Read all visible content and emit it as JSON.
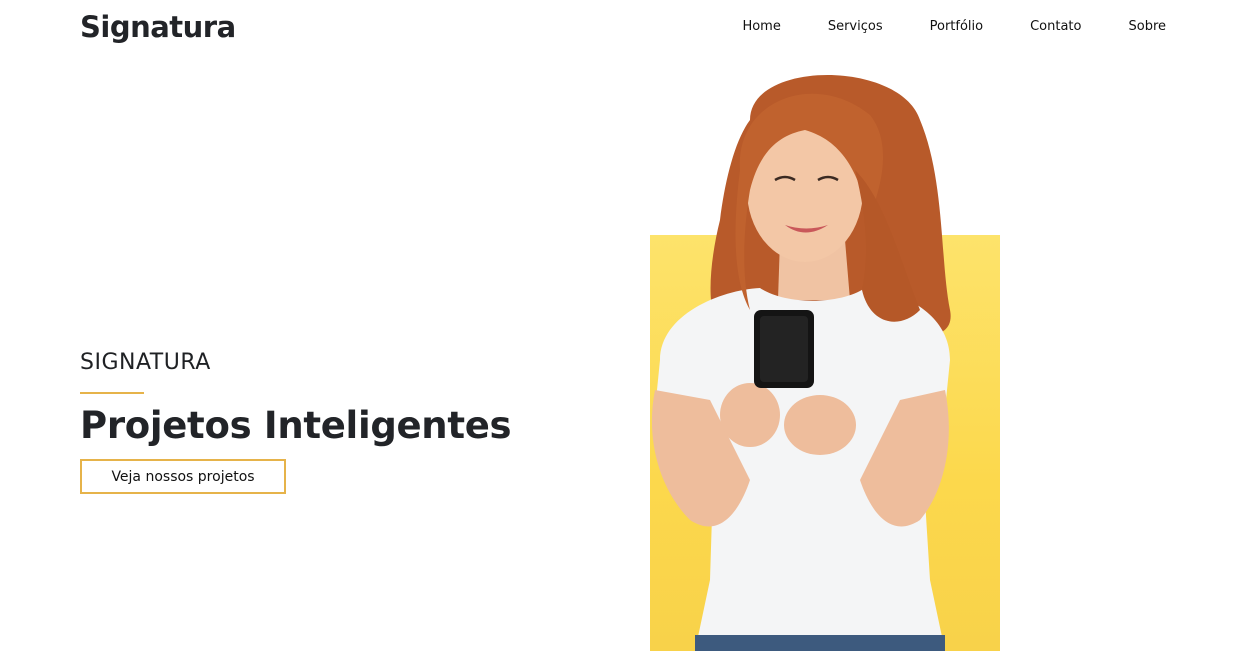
{
  "header": {
    "brand": "Signatura",
    "nav": [
      "Home",
      "Serviços",
      "Portfólio",
      "Contato",
      "Sobre"
    ]
  },
  "hero": {
    "eyebrow": "SIGNATURA",
    "headline": "Projetos Inteligentes",
    "cta_label": "Veja nossos projetos"
  },
  "colors": {
    "accent": "#e6b34a",
    "hero_block": "#fcd84c",
    "text_dark": "#222428"
  },
  "image": {
    "subject": "woman-using-smartphone"
  }
}
